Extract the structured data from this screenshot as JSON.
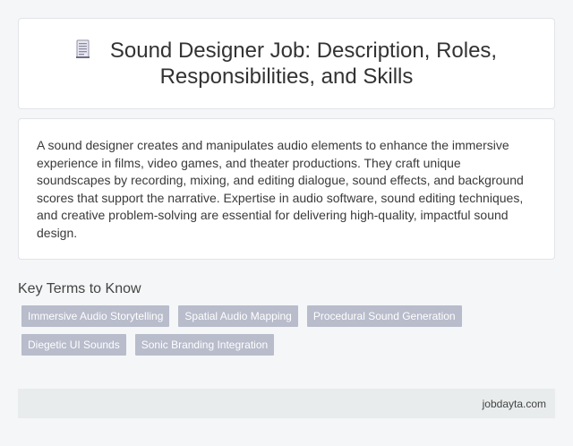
{
  "header": {
    "icon": "document-icon",
    "title": "Sound Designer Job: Description, Roles, Responsibilities, and Skills"
  },
  "description": {
    "text": "A sound designer creates and manipulates audio elements to enhance the immersive experience in films, video games, and theater productions. They craft unique soundscapes by recording, mixing, and editing dialogue, sound effects, and background scores that support the narrative. Expertise in audio software, sound editing techniques, and creative problem-solving are essential for delivering high-quality, impactful sound design."
  },
  "key_terms": {
    "heading": "Key Terms to Know",
    "tags": [
      "Immersive Audio Storytelling",
      "Spatial Audio Mapping",
      "Procedural Sound Generation",
      "Diegetic UI Sounds",
      "Sonic Branding Integration"
    ]
  },
  "footer": {
    "site": "jobdayta.com"
  },
  "colors": {
    "tag_bg": "#b8bccb",
    "footer_bg": "#e8ecec",
    "page_bg": "#f5f6f8"
  }
}
